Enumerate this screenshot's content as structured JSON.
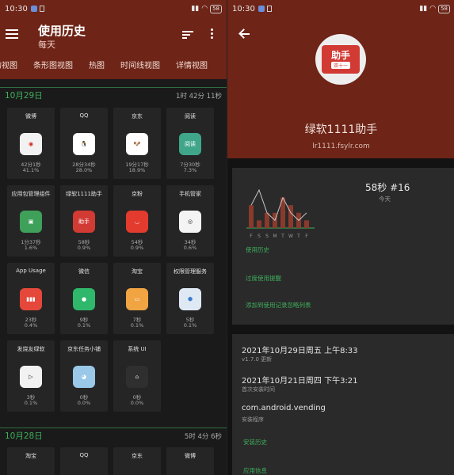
{
  "status_bar": {
    "time": "10:30",
    "battery": "58"
  },
  "left": {
    "title": "使用历史",
    "subtitle": "每天",
    "tabs": [
      "的视图",
      "条形图视图",
      "热图",
      "时间线视图",
      "详情视图"
    ],
    "days": [
      {
        "date": "10月29日",
        "total": "1时 42分 11秒",
        "apps": [
          {
            "name": "微博",
            "time": "42分1秒",
            "percent": "41.1%",
            "icon": "weibo-icon",
            "color": "#f2f2f2",
            "glyph": "◉",
            "glyph_color": "#d52b1e"
          },
          {
            "name": "QQ",
            "time": "28分34秒",
            "percent": "28.0%",
            "icon": "qq-penguin-icon",
            "color": "#ffffff",
            "glyph": "🐧",
            "glyph_color": "#111"
          },
          {
            "name": "京东",
            "time": "19分17秒",
            "percent": "18.9%",
            "icon": "jd-dog-icon",
            "color": "#ffffff",
            "glyph": "🐶",
            "glyph_color": "#999"
          },
          {
            "name": "阅读",
            "time": "7分30秒",
            "percent": "7.3%",
            "icon": "reading-book-icon",
            "color": "#3fa68a",
            "glyph": "阅读",
            "glyph_color": "#fff"
          },
          {
            "name": "应用包管理组件",
            "time": "1分37秒",
            "percent": "1.6%",
            "icon": "android-icon",
            "color": "#3fa05a",
            "glyph": "▣",
            "glyph_color": "#fff"
          },
          {
            "name": "绿软1111助手",
            "time": "58秒",
            "percent": "0.9%",
            "icon": "helper-app-icon",
            "color": "#d23a34",
            "glyph": "助手",
            "glyph_color": "#fff"
          },
          {
            "name": "京粉",
            "time": "54秒",
            "percent": "0.9%",
            "icon": "jingfen-smile-icon",
            "color": "#e33b2e",
            "glyph": "◡",
            "glyph_color": "#fff"
          },
          {
            "name": "手机管家",
            "time": "34秒",
            "percent": "0.6%",
            "icon": "phone-manager-icon",
            "color": "#f4f4f4",
            "glyph": "◎",
            "glyph_color": "#222"
          },
          {
            "name": "App Usage",
            "time": "23秒",
            "percent": "0.4%",
            "icon": "app-usage-chart-icon",
            "color": "#e5473a",
            "glyph": "▮▮▮",
            "glyph_color": "#fff"
          },
          {
            "name": "微信",
            "time": "9秒",
            "percent": "0.1%",
            "icon": "wechat-icon",
            "color": "#2fb86b",
            "glyph": "●",
            "glyph_color": "#fff"
          },
          {
            "name": "淘宝",
            "time": "7秒",
            "percent": "0.1%",
            "icon": "taobao-bag-icon",
            "color": "#f0a442",
            "glyph": "▭",
            "glyph_color": "#fff"
          },
          {
            "name": "权限管理服务",
            "time": "5秒",
            "percent": "0.1%",
            "icon": "permission-shield-icon",
            "color": "#dfe9f4",
            "glyph": "⬢",
            "glyph_color": "#3a7ccc"
          },
          {
            "name": "发烧友绿软",
            "time": "3秒",
            "percent": "0.1%",
            "icon": "fan-app-icon",
            "color": "#f2f2f2",
            "glyph": "▷",
            "glyph_color": "#222"
          },
          {
            "name": "京东任务小铺",
            "time": "0秒",
            "percent": "0.0%",
            "icon": "jd-task-shop-icon",
            "color": "#9ac8e8",
            "glyph": "◕",
            "glyph_color": "#fff"
          },
          {
            "name": "系统 UI",
            "time": "0秒",
            "percent": "0.0%",
            "icon": "system-ui-icon",
            "color": "#2f2f2f",
            "glyph": "⌂",
            "glyph_color": "#ddd"
          }
        ]
      },
      {
        "date": "10月28日",
        "total": "5时 4分 6秒",
        "apps": [
          {
            "name": "淘宝"
          },
          {
            "name": "QQ"
          },
          {
            "name": "京东"
          },
          {
            "name": "微博"
          }
        ]
      }
    ]
  },
  "right": {
    "app_name": "绿软1111助手",
    "app_url": "lr1111.fsylr.com",
    "logo_main": "助手",
    "logo_sub": "双十一",
    "usage": {
      "value": "58秒 #16",
      "label": "今天"
    },
    "chart_data": {
      "type": "bar",
      "categories": [
        "F",
        "S",
        "S",
        "M",
        "T",
        "W",
        "T",
        "F"
      ],
      "values": [
        3,
        1,
        2,
        2,
        4,
        3,
        2,
        1
      ],
      "line_values": [
        3,
        5,
        2,
        1,
        4,
        2,
        1,
        2
      ]
    },
    "links": [
      "使用历史",
      "过度使用提醒",
      "添加到使用记录忽略列表"
    ],
    "info": [
      {
        "main": "2021年10月29日周五 上午8:33",
        "sub": "v1.7.0 更新"
      },
      {
        "main": "2021年10月21日周四 下午3:21",
        "sub": "首次安装时间"
      },
      {
        "main": "com.android.vending",
        "sub": "安装程序"
      }
    ],
    "links2": [
      "安装历史",
      "应用信息"
    ]
  }
}
